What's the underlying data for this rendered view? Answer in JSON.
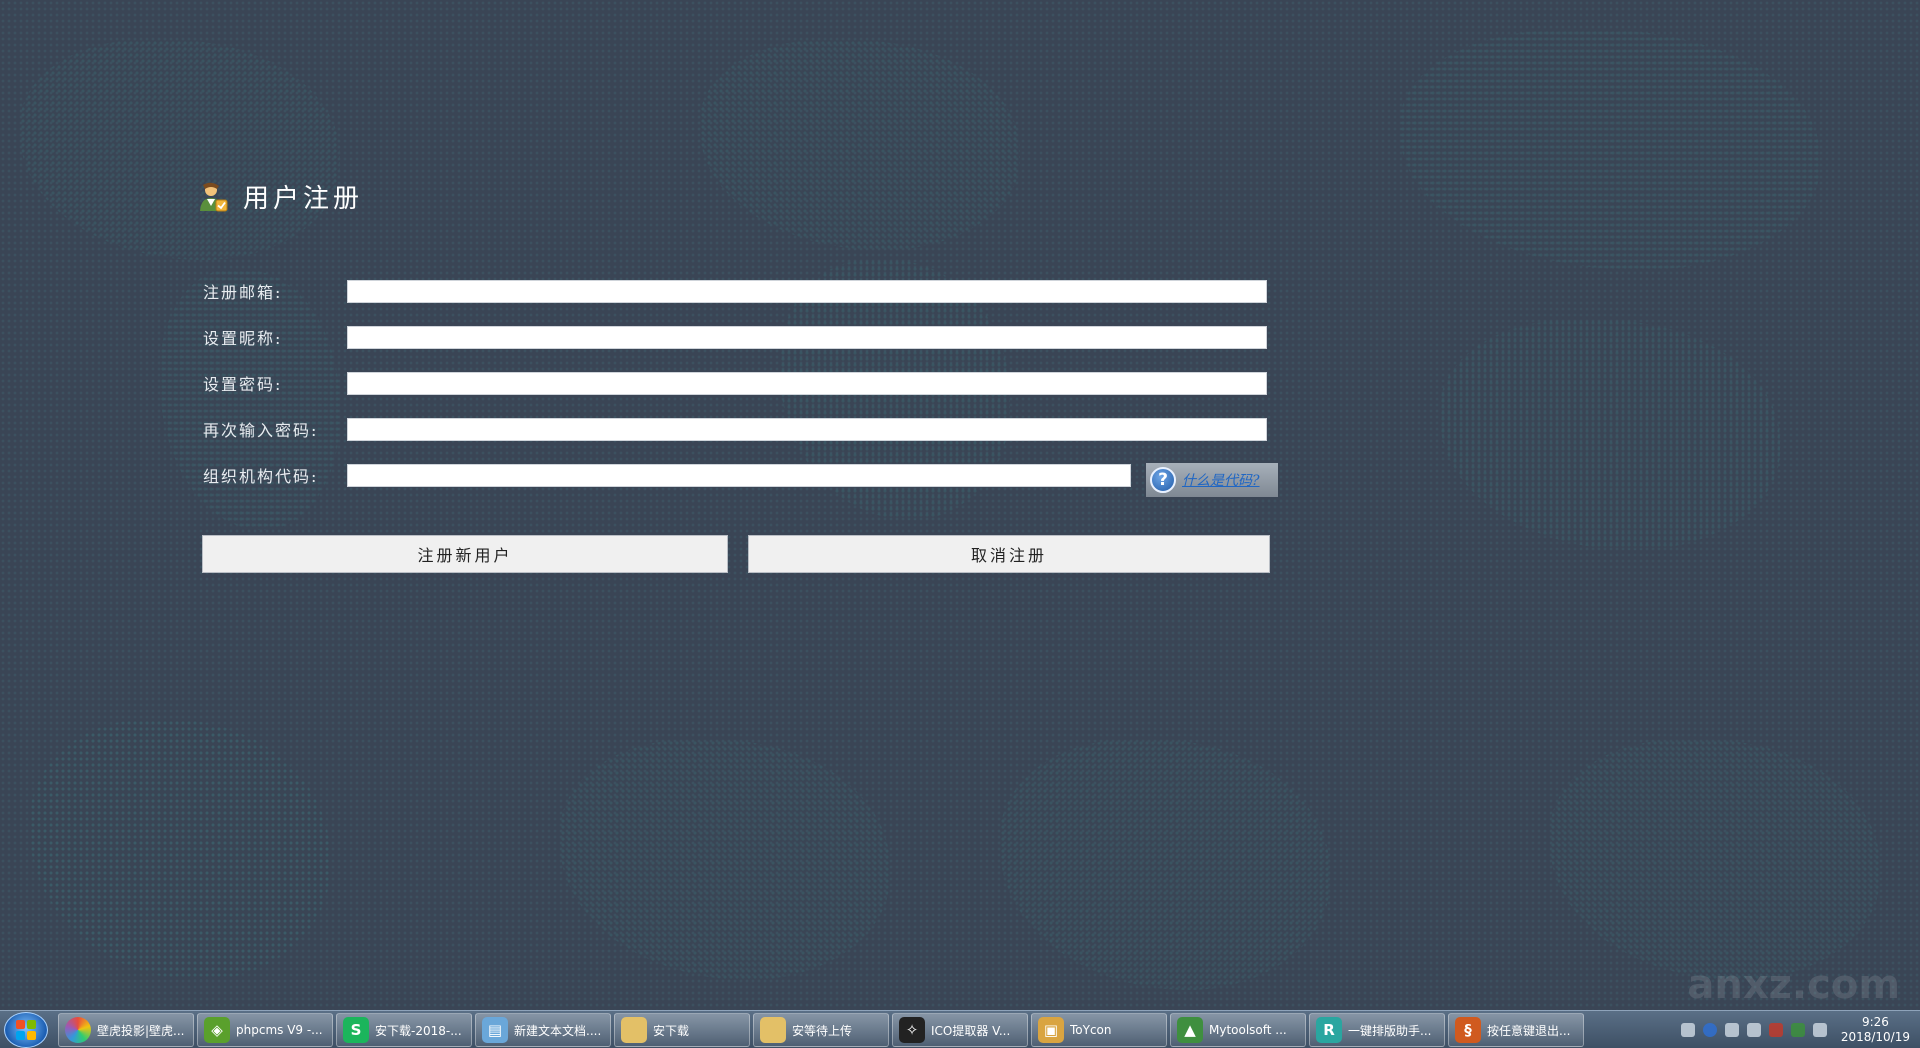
{
  "title": "用户注册",
  "form": {
    "fields": [
      {
        "label": "注册邮箱:",
        "value": ""
      },
      {
        "label": "设置昵称:",
        "value": ""
      },
      {
        "label": "设置密码:",
        "value": ""
      },
      {
        "label": "再次输入密码:",
        "value": ""
      },
      {
        "label": "组织机构代码:",
        "value": ""
      }
    ],
    "help_link": "什么是代码?",
    "register_button": "注册新用户",
    "cancel_button": "取消注册"
  },
  "taskbar": {
    "items": [
      {
        "label": "壁虎投影|壁虎...",
        "icon": "color-wheel-icon",
        "color": "#e84c3d"
      },
      {
        "label": "phpcms V9 -...",
        "icon": "shield-app-icon",
        "color": "#5aa02c"
      },
      {
        "label": "安下载-2018-...",
        "icon": "wps-s-icon",
        "color": "#1bb55c"
      },
      {
        "label": "新建文本文档....",
        "icon": "notepad-icon",
        "color": "#6aa7d9"
      },
      {
        "label": "安下载",
        "icon": "folder-icon",
        "color": "#e3c067"
      },
      {
        "label": "安等待上传",
        "icon": "folder-icon",
        "color": "#e3c067"
      },
      {
        "label": "ICO提取器 V...",
        "icon": "ico-extractor-icon",
        "color": "#222222"
      },
      {
        "label": "ToYcon",
        "icon": "box-icon",
        "color": "#d9a441"
      },
      {
        "label": "Mytoolsoft ...",
        "icon": "image-icon",
        "color": "#3f8f3f"
      },
      {
        "label": "一键排版助手...",
        "icon": "r-logo-icon",
        "color": "#2aa6a0"
      },
      {
        "label": "按任意键退出...",
        "icon": "dragon-icon",
        "color": "#d05a1f"
      }
    ],
    "clock_time": "9:26",
    "clock_date": "2018/10/19"
  },
  "watermark": "anxz.com",
  "colors": {
    "background": "#3b4656",
    "map_dots": "#3c9696",
    "link": "#1f66c4",
    "button": "#f0f0f0"
  }
}
